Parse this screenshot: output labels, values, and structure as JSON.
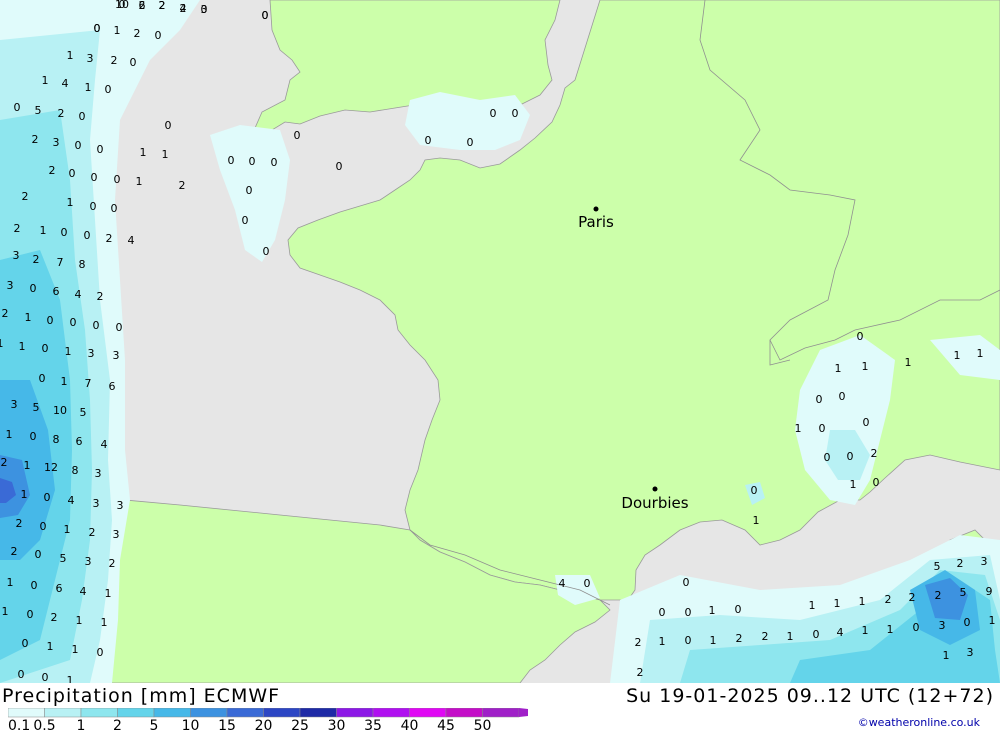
{
  "title_left": "Precipitation [mm] ECMWF",
  "title_right": "Su 19-01-2025 09..12 UTC (12+72)",
  "credit": "©weatheronline.co.uk",
  "colors": {
    "sea": "#e6e6e6",
    "land": "#ccff aa",
    "land_fill": "#ccffaa",
    "border": "#909090"
  },
  "legend": {
    "labels": [
      "0.1",
      "0.5",
      "1",
      "2",
      "5",
      "10",
      "15",
      "20",
      "25",
      "30",
      "35",
      "40",
      "45",
      "50"
    ],
    "colors": [
      "#e0fbfb",
      "#b8f1f4",
      "#8ee6ee",
      "#64d4ea",
      "#46b8e8",
      "#3d92e0",
      "#3a6ad6",
      "#2c46c4",
      "#1e2aa6",
      "#8c18e6",
      "#b010f0",
      "#e008f4",
      "#c40ec8",
      "#a020c8"
    ]
  },
  "cities": [
    {
      "name": "Paris"
    },
    {
      "name": "Dourbies"
    }
  ],
  "values": [
    {
      "v": "0"
    },
    {
      "v": "2"
    },
    {
      "v": "2"
    },
    {
      "v": "2"
    },
    {
      "v": "0"
    },
    {
      "v": "0"
    },
    {
      "v": "0"
    },
    {
      "v": "1"
    },
    {
      "v": "2"
    },
    {
      "v": "0"
    },
    {
      "v": "1"
    },
    {
      "v": "3"
    },
    {
      "v": "2"
    },
    {
      "v": "0"
    },
    {
      "v": "1"
    },
    {
      "v": "4"
    },
    {
      "v": "1"
    },
    {
      "v": "0"
    },
    {
      "v": "0"
    },
    {
      "v": "5"
    },
    {
      "v": "2"
    },
    {
      "v": "0"
    },
    {
      "v": "2"
    },
    {
      "v": "3"
    },
    {
      "v": "0"
    },
    {
      "v": "0"
    },
    {
      "v": "0"
    },
    {
      "v": "1"
    },
    {
      "v": "1"
    },
    {
      "v": "2"
    },
    {
      "v": "0"
    },
    {
      "v": "0"
    },
    {
      "v": "0"
    },
    {
      "v": "1"
    },
    {
      "v": "2"
    },
    {
      "v": "1"
    },
    {
      "v": "0"
    },
    {
      "v": "0"
    },
    {
      "v": "2"
    },
    {
      "v": "2"
    },
    {
      "v": "1"
    },
    {
      "v": "0"
    },
    {
      "v": "0"
    },
    {
      "v": "2"
    },
    {
      "v": "4"
    },
    {
      "v": "3"
    },
    {
      "v": "2"
    },
    {
      "v": "7"
    },
    {
      "v": "8"
    },
    {
      "v": "3"
    },
    {
      "v": "0"
    },
    {
      "v": "6"
    },
    {
      "v": "4"
    },
    {
      "v": "2"
    },
    {
      "v": "2"
    },
    {
      "v": "1"
    },
    {
      "v": "0"
    },
    {
      "v": "0"
    },
    {
      "v": "0"
    },
    {
      "v": "0"
    },
    {
      "v": "1"
    },
    {
      "v": "1"
    },
    {
      "v": "0"
    },
    {
      "v": "1"
    },
    {
      "v": "3"
    },
    {
      "v": "3"
    },
    {
      "v": "0"
    },
    {
      "v": "1"
    },
    {
      "v": "7"
    },
    {
      "v": "6"
    },
    {
      "v": "3"
    },
    {
      "v": "5"
    },
    {
      "v": "10"
    },
    {
      "v": "5"
    },
    {
      "v": "1"
    },
    {
      "v": "0"
    },
    {
      "v": "8"
    },
    {
      "v": "6"
    },
    {
      "v": "4"
    },
    {
      "v": "2"
    },
    {
      "v": "1"
    },
    {
      "v": "12"
    },
    {
      "v": "8"
    },
    {
      "v": "3"
    },
    {
      "v": "1"
    },
    {
      "v": "0"
    },
    {
      "v": "4"
    },
    {
      "v": "3"
    },
    {
      "v": "3"
    },
    {
      "v": "2"
    },
    {
      "v": "0"
    },
    {
      "v": "1"
    },
    {
      "v": "2"
    },
    {
      "v": "3"
    },
    {
      "v": "2"
    },
    {
      "v": "0"
    },
    {
      "v": "5"
    },
    {
      "v": "3"
    },
    {
      "v": "2"
    },
    {
      "v": "1"
    },
    {
      "v": "0"
    },
    {
      "v": "6"
    },
    {
      "v": "4"
    },
    {
      "v": "1"
    },
    {
      "v": "1"
    },
    {
      "v": "0"
    },
    {
      "v": "2"
    },
    {
      "v": "1"
    },
    {
      "v": "1"
    },
    {
      "v": "0"
    },
    {
      "v": "1"
    },
    {
      "v": "1"
    },
    {
      "v": "0"
    },
    {
      "v": "0"
    },
    {
      "v": "0"
    },
    {
      "v": "1"
    },
    {
      "v": "0"
    },
    {
      "v": "0"
    },
    {
      "v": "0"
    },
    {
      "v": "0"
    },
    {
      "v": "0"
    },
    {
      "v": "0"
    },
    {
      "v": "0"
    },
    {
      "v": "0"
    },
    {
      "v": "0"
    },
    {
      "v": "0"
    },
    {
      "v": "0"
    },
    {
      "v": "0"
    },
    {
      "v": "0"
    },
    {
      "v": "1"
    },
    {
      "v": "1"
    },
    {
      "v": "1"
    },
    {
      "v": "1"
    },
    {
      "v": "1"
    },
    {
      "v": "0"
    },
    {
      "v": "0"
    },
    {
      "v": "0"
    },
    {
      "v": "1"
    },
    {
      "v": "0"
    },
    {
      "v": "0"
    },
    {
      "v": "0"
    },
    {
      "v": "2"
    },
    {
      "v": "1"
    },
    {
      "v": "0"
    },
    {
      "v": "0"
    },
    {
      "v": "1"
    },
    {
      "v": "4"
    },
    {
      "v": "0"
    },
    {
      "v": "0"
    },
    {
      "v": "0"
    },
    {
      "v": "0"
    },
    {
      "v": "1"
    },
    {
      "v": "0"
    },
    {
      "v": "1"
    },
    {
      "v": "1"
    },
    {
      "v": "1"
    },
    {
      "v": "2"
    },
    {
      "v": "2"
    },
    {
      "v": "5"
    },
    {
      "v": "2"
    },
    {
      "v": "3"
    },
    {
      "v": "2"
    },
    {
      "v": "5"
    },
    {
      "v": "9"
    },
    {
      "v": "2"
    },
    {
      "v": "1"
    },
    {
      "v": "0"
    },
    {
      "v": "1"
    },
    {
      "v": "2"
    },
    {
      "v": "2"
    },
    {
      "v": "1"
    },
    {
      "v": "0"
    },
    {
      "v": "4"
    },
    {
      "v": "1"
    },
    {
      "v": "1"
    },
    {
      "v": "0"
    },
    {
      "v": "3"
    },
    {
      "v": "0"
    },
    {
      "v": "1"
    },
    {
      "v": "1"
    },
    {
      "v": "3"
    },
    {
      "v": "2"
    },
    {
      "v": "10"
    },
    {
      "v": "6"
    },
    {
      "v": "2"
    },
    {
      "v": "4"
    },
    {
      "v": "3"
    },
    {
      "v": "0"
    },
    {
      "v": "0"
    }
  ]
}
